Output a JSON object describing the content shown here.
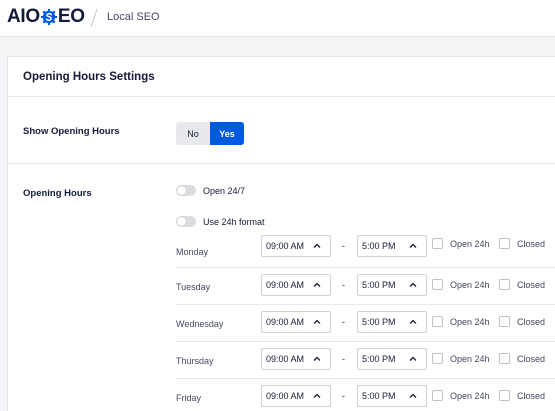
{
  "header": {
    "logo_prefix": "AIO",
    "logo_suffix": "EO",
    "breadcrumb": "Local SEO"
  },
  "card": {
    "title": "Opening Hours Settings",
    "show_hours": {
      "label": "Show Opening Hours",
      "no_label": "No",
      "yes_label": "Yes",
      "selected": "Yes"
    },
    "hours": {
      "label": "Opening Hours",
      "open_247_label": "Open 24/7",
      "open_247_on": false,
      "use_24h_label": "Use 24h format",
      "use_24h_on": false,
      "separator": "-",
      "open24h_label": "Open 24h",
      "closed_label": "Closed",
      "days": [
        {
          "name": "Monday",
          "open": "09:00 AM",
          "close": "5:00 PM"
        },
        {
          "name": "Tuesday",
          "open": "09:00 AM",
          "close": "5:00 PM"
        },
        {
          "name": "Wednesday",
          "open": "09:00 AM",
          "close": "5:00 PM"
        },
        {
          "name": "Thursday",
          "open": "09:00 AM",
          "close": "5:00 PM"
        },
        {
          "name": "Friday",
          "open": "09:00 AM",
          "close": "5:00 PM"
        }
      ]
    }
  },
  "colors": {
    "brand_blue": "#005ae0",
    "text_dark": "#141b38",
    "background": "#f3f4f5"
  }
}
